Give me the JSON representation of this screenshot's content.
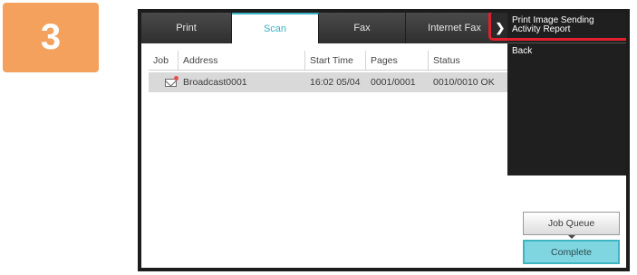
{
  "step": {
    "number": "3"
  },
  "tabs": [
    {
      "label": "Print",
      "active": false
    },
    {
      "label": "Scan",
      "active": true
    },
    {
      "label": "Fax",
      "active": false
    },
    {
      "label": "Internet Fax",
      "active": false
    }
  ],
  "tab_scroll": {
    "icon": "chevron-right-icon",
    "glyph": "❯"
  },
  "table": {
    "columns": [
      "Job",
      "Address",
      "Start Time",
      "Pages",
      "Status"
    ],
    "rows": [
      {
        "icon": "mail-send-icon",
        "address": "Broadcast0001",
        "start_time": "16:02 05/04",
        "pages": "0001/0001",
        "status": "0010/0010 OK"
      }
    ]
  },
  "menu": {
    "items": [
      {
        "label": "Print Image Sending Activity Report",
        "highlighted": true
      },
      {
        "label": "Back",
        "highlighted": false
      }
    ],
    "highlight_color": "#e0202e"
  },
  "buttons": {
    "job_queue": "Job Queue",
    "complete": "Complete"
  },
  "colors": {
    "badge": "#f4a15d",
    "accent": "#39b3c4",
    "complete_bg": "#7fd6e0"
  }
}
